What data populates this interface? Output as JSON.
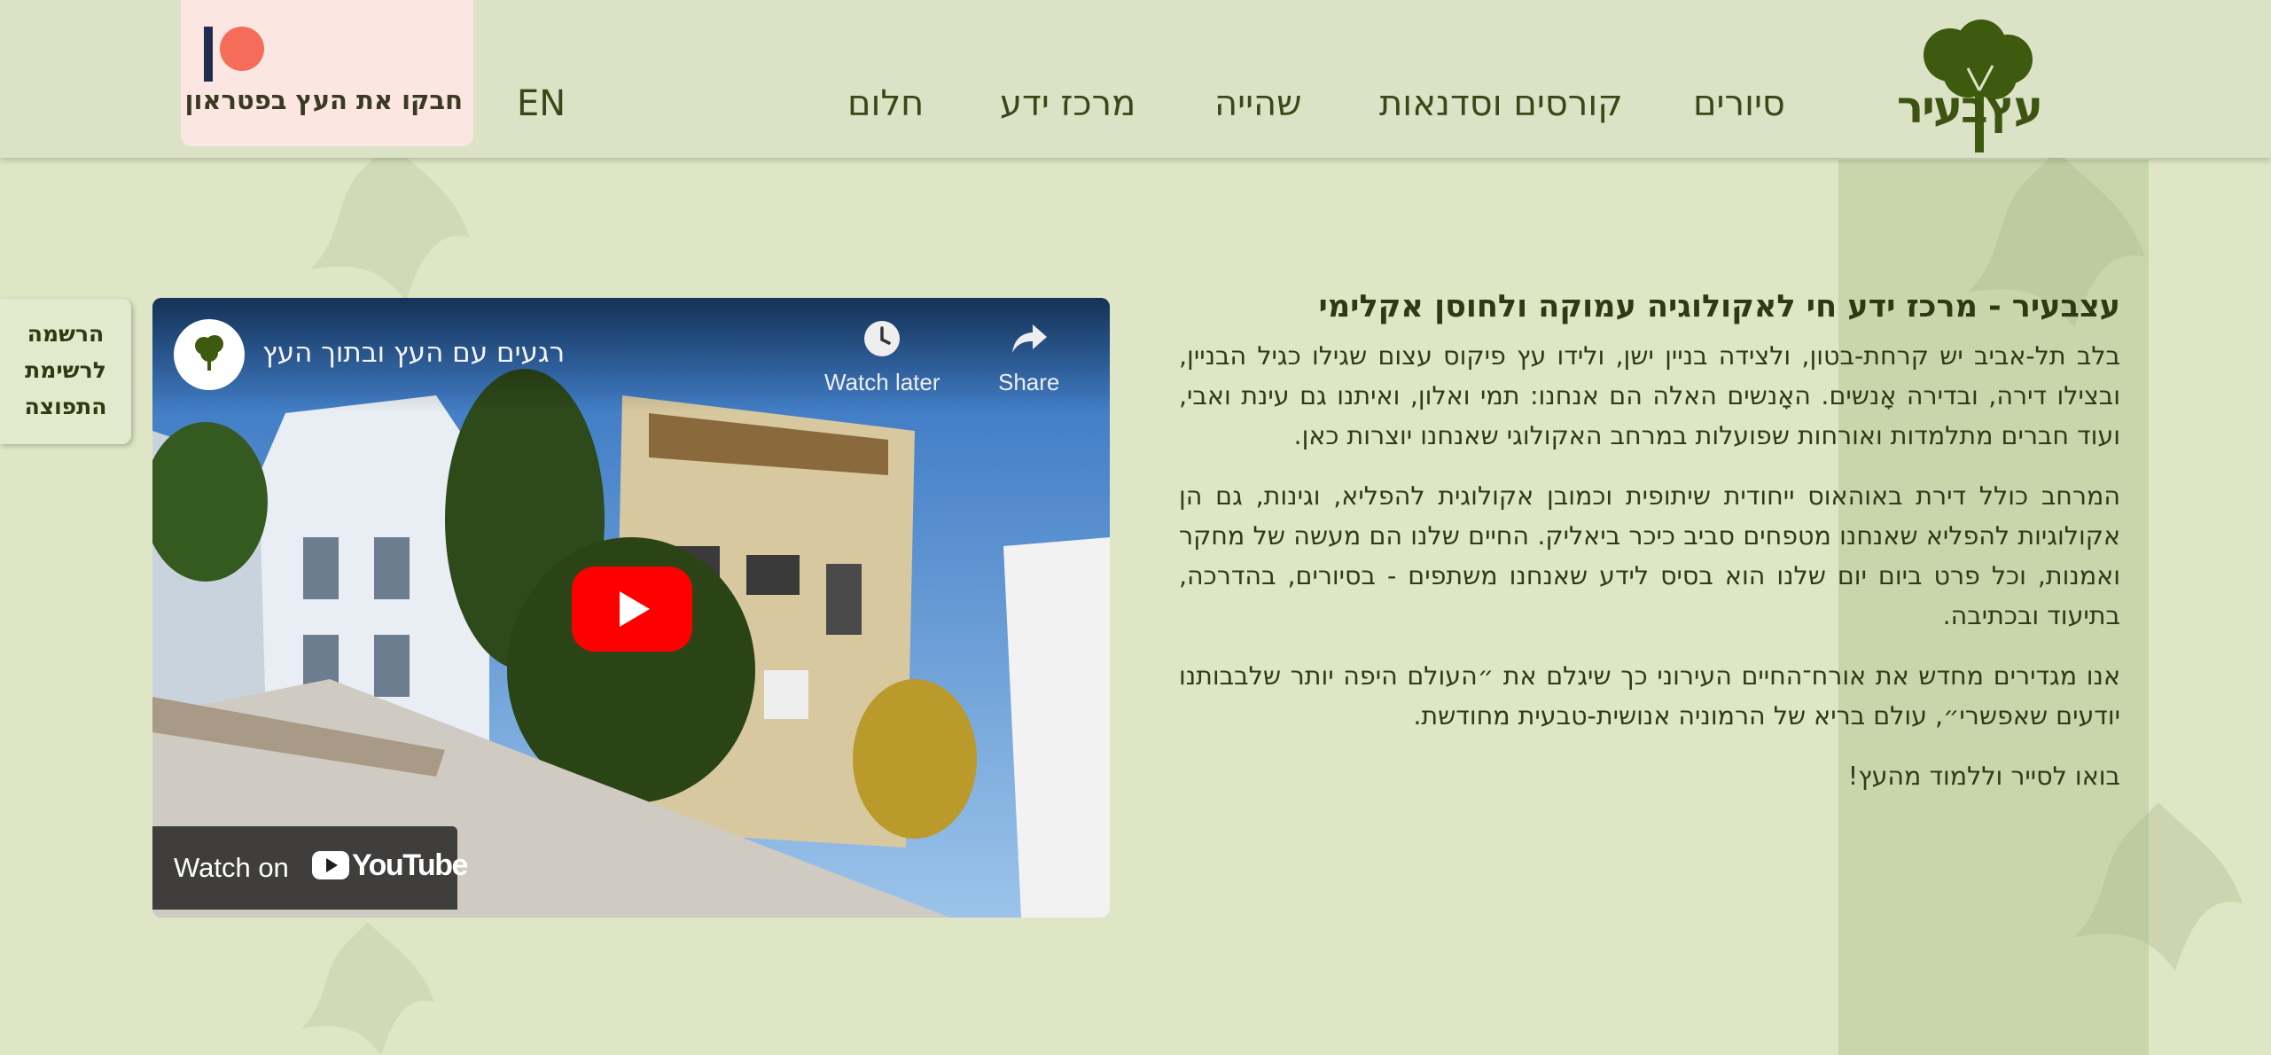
{
  "header": {
    "logo_text": "עץבעיר",
    "nav": [
      {
        "label": "סיורים"
      },
      {
        "label": "קורסים וסדנאות"
      },
      {
        "label": "שהייה"
      },
      {
        "label": "מרכז ידע"
      },
      {
        "label": "חלום"
      }
    ],
    "lang_label": "EN",
    "patreon_label": "חבקו את העץ בפטראון"
  },
  "side_tab": {
    "lines": [
      "הרשמה",
      "לרשימת",
      "התפוצה"
    ]
  },
  "video": {
    "title": "רגעים עם העץ ובתוך העץ",
    "watch_later_label": "Watch later",
    "share_label": "Share",
    "watch_on_label": "Watch on",
    "youtube_label": "YouTube",
    "avatar_icon": "tree-logo-icon"
  },
  "content": {
    "heading": "עצבעיר - מרכז ידע חי לאקולוגיה עמוקה ולחוסן אקלימי",
    "paragraphs": [
      "בלב תל-אביב יש קרחת-בטון, ולצידה בניין ישן, ולידו עץ פיקוס עצום שגילו כגיל הבניין, ובצילו דירה, ובדירה אָנשים. האָנשים האלה הם אנחנו: תמי ואלון, ואיתנו גם עינת ואבי, ועוד חברים מתלמדות ואורחות שפועלות במרחב האקולוגי שאנחנו יוצרות כאן.",
      "המרחב כולל דירת באוהאוס ייחודית שיתופית וכמובן אקולוגית להפליא, וגינות, גם הן אקולוגיות להפליא שאנחנו מטפחים סביב כיכר ביאליק. החיים שלנו הם מעשה של מחקר ואמנות, וכל פרט ביום יום שלנו הוא בסיס לידע שאנחנו משתפים - בסיורים, בהדרכה, בתיעוד ובכתיבה.",
      "אנו מגדירים מחדש את אורח־החיים העירוני כך שיגלם את ״העולם היפה יותר שלבבותנו יודעים שאפשרי״, עולם בריא של הרמוניה אנושית-טבעית מחודשת.",
      "בואו לסייר וללמוד מהעץ!"
    ]
  },
  "colors": {
    "page_bg": "#dfe6c6",
    "header_bg": "#dce2c6",
    "brand_green": "#3d5311",
    "patreon_bg": "#fbe6e2",
    "patreon_dot": "#f56c58",
    "youtube_red": "#ff0000"
  }
}
